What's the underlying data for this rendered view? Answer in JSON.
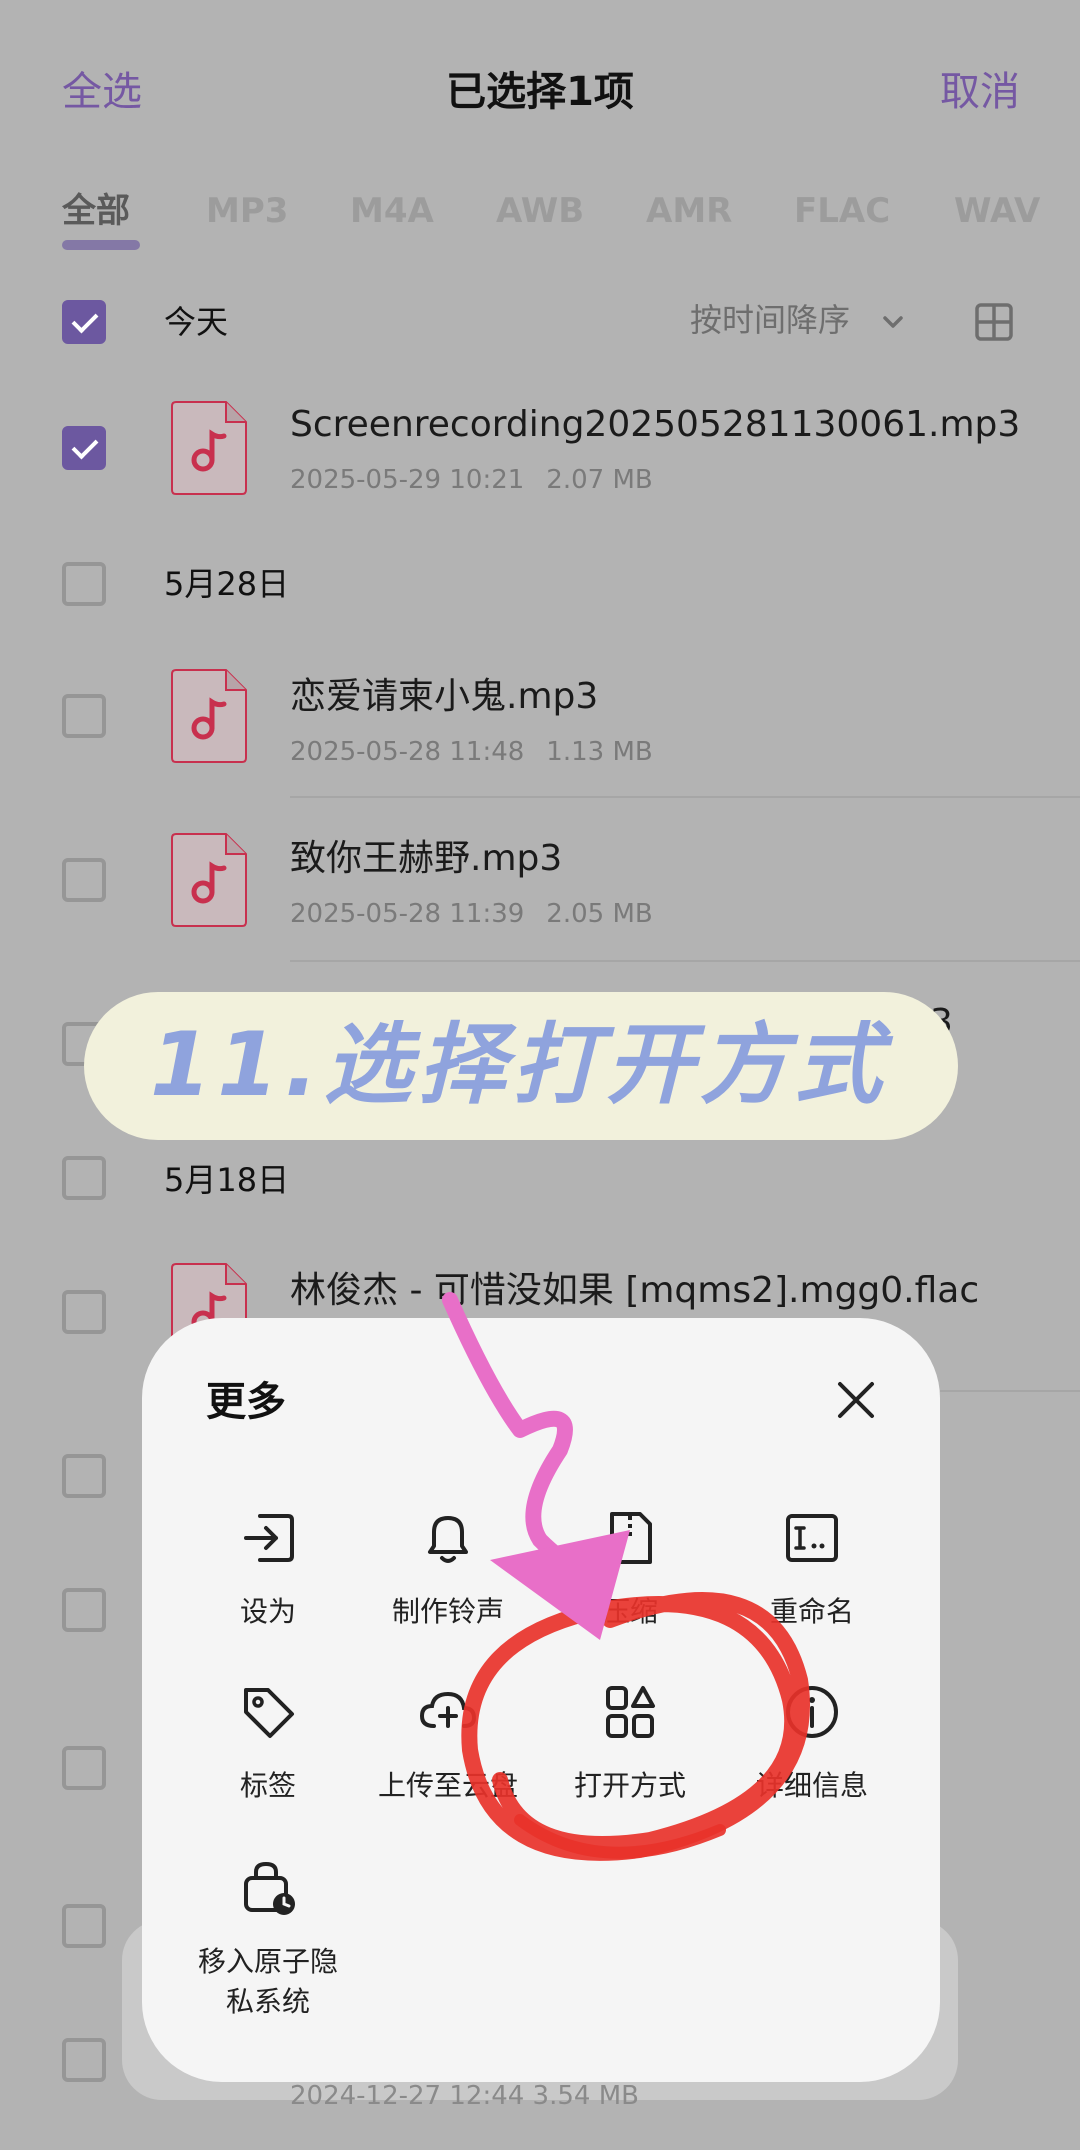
{
  "header": {
    "select_all": "全选",
    "title": "已选择1项",
    "cancel": "取消"
  },
  "tabs": [
    {
      "label": "全部",
      "active": true
    },
    {
      "label": "MP3"
    },
    {
      "label": "M4A"
    },
    {
      "label": "AWB"
    },
    {
      "label": "AMR"
    },
    {
      "label": "FLAC"
    },
    {
      "label": "WAV"
    }
  ],
  "list": {
    "sort_label": "按时间降序",
    "groups": [
      {
        "label": "今天",
        "checked": true
      },
      {
        "label": "5月28日",
        "checked": false
      },
      {
        "label": "5月18日",
        "checked": false
      }
    ],
    "files": [
      {
        "name": "Screenrecording202505281130061.mp3",
        "date": "2025-05-29 10:21",
        "size": "2.07 MB",
        "checked": true
      },
      {
        "name": "恋爱请柬小鬼.mp3",
        "date": "2025-05-28 11:48",
        "size": "1.13 MB",
        "checked": false
      },
      {
        "name": "致你王赫野.mp3",
        "date": "2025-05-28 11:39",
        "size": "2.05 MB",
        "checked": false
      },
      {
        "name": "林俊杰 - 可惜没如果 [mqms2].mgg0.flac",
        "checked": false
      }
    ],
    "partial_row_suffix": "3",
    "partial_bottom_meta": "2024-12-27 12:44   3.54 MB"
  },
  "sticker": {
    "text": "11.选择打开方式"
  },
  "sheet": {
    "title": "更多",
    "actions": [
      {
        "label": "设为",
        "icon": "login-arrow-icon"
      },
      {
        "label": "制作铃声",
        "icon": "bell-icon"
      },
      {
        "label": "压缩",
        "icon": "zip-file-icon"
      },
      {
        "label": "重命名",
        "icon": "rename-icon"
      },
      {
        "label": "标签",
        "icon": "tag-icon"
      },
      {
        "label": "上传至云盘",
        "icon": "cloud-upload-icon"
      },
      {
        "label": "打开方式",
        "icon": "apps-grid-icon"
      },
      {
        "label": "详细信息",
        "icon": "info-icon"
      },
      {
        "label": "移入原子隐私系统",
        "label_line1": "移入原子隐",
        "label_line2": "私系统",
        "icon": "lock-clock-icon"
      }
    ]
  },
  "colors": {
    "accent": "#7558a3",
    "checkbox_checked": "#6c58a0",
    "music_icon": "#c8304e",
    "highlight_circle": "#e8322a",
    "arrow": "#e86fc8",
    "sticker_bg": "#f2f1dc",
    "sticker_text": "#8fa3dd"
  }
}
